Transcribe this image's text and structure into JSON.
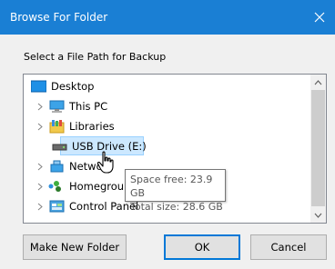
{
  "window": {
    "title": "Browse For Folder",
    "close_glyph": "✕"
  },
  "prompt": "Select a File Path for Backup",
  "tree": {
    "items": [
      {
        "label": "Desktop",
        "icon": "desktop-icon",
        "expandable": false
      },
      {
        "label": "This PC",
        "icon": "computer-icon",
        "expandable": true
      },
      {
        "label": "Libraries",
        "icon": "libraries-icon",
        "expandable": true
      },
      {
        "label": "USB Drive (E:)",
        "icon": "usb-drive-icon",
        "expandable": false,
        "selected": true
      },
      {
        "label": "Network",
        "icon": "network-icon",
        "expandable": true
      },
      {
        "label": "Homegroup",
        "icon": "homegroup-icon",
        "expandable": true
      },
      {
        "label": "Control Panel",
        "icon": "control-panel-icon",
        "expandable": true
      }
    ]
  },
  "tooltip": {
    "line1": "Space free: 23.9 GB",
    "line2": "Total size: 28.6 GB"
  },
  "buttons": {
    "new_folder": "Make New Folder",
    "ok": "OK",
    "cancel": "Cancel"
  },
  "colors": {
    "titlebar": "#1a7fd4",
    "selection": "#cce8ff"
  }
}
